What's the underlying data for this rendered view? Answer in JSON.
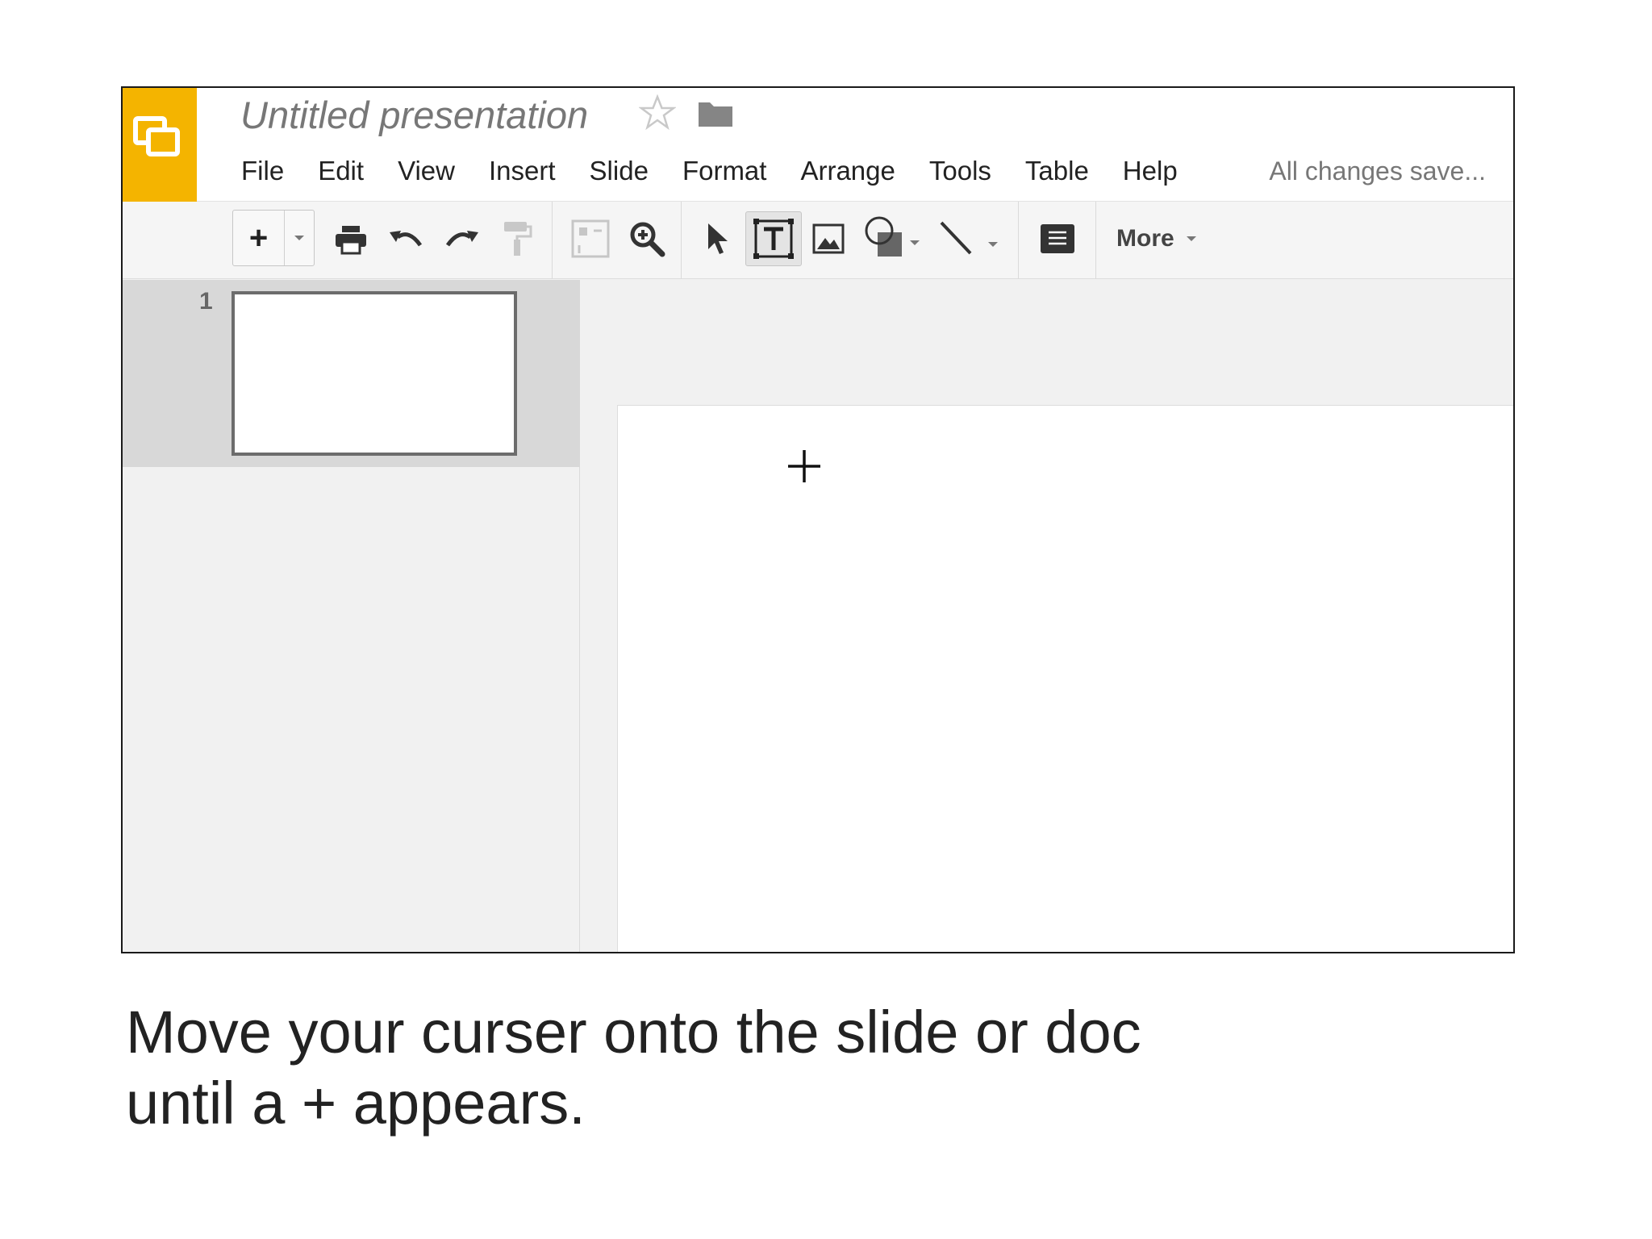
{
  "app": {
    "title": "Untitled presentation",
    "logo_icon": "slides-logo-icon",
    "brand_color": "#f4b400",
    "save_status": "All changes save..."
  },
  "menu": [
    "File",
    "Edit",
    "View",
    "Insert",
    "Slide",
    "Format",
    "Arrange",
    "Tools",
    "Table",
    "Help"
  ],
  "toolbar": {
    "new_slide_label": "+",
    "more_label": "More",
    "icons": [
      "plus-icon",
      "print-icon",
      "undo-icon",
      "redo-icon",
      "paint-format-icon",
      "fit-icon",
      "zoom-icon",
      "select-arrow-icon",
      "text-box-icon",
      "image-icon",
      "shape-icon",
      "line-icon",
      "speaker-notes-icon"
    ]
  },
  "filmstrip": {
    "slides": [
      {
        "number": "1"
      }
    ]
  },
  "canvas": {
    "cursor": "+"
  },
  "instruction": {
    "line1": "Move your curser onto the slide or doc",
    "line2": "until a + appears."
  }
}
